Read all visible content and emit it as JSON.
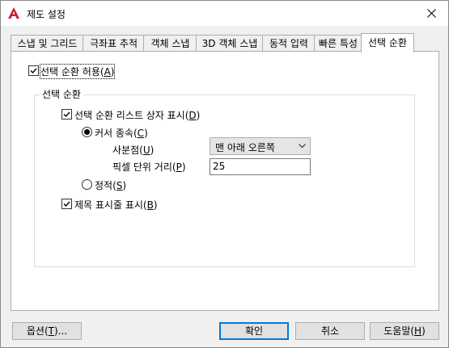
{
  "window": {
    "title": "제도 설정",
    "accent_color": "#c8232c"
  },
  "tabs": [
    {
      "label": "스냅 및 그리드"
    },
    {
      "label": "극좌표 추적"
    },
    {
      "label": "객체 스냅"
    },
    {
      "label": "3D 객체 스냅"
    },
    {
      "label": "동적 입력"
    },
    {
      "label": "빠른 특성"
    },
    {
      "label": "선택 순환"
    }
  ],
  "active_tab": "선택 순환",
  "panel": {
    "allow_cycling": {
      "label": "선택 순환 허용",
      "key": "A",
      "checked": true
    },
    "group_title": "선택 순환",
    "show_list_box": {
      "label": "선택 순환 리스트 상자 표시",
      "key": "D",
      "checked": true
    },
    "cursor_dependent": {
      "label": "커서 종속",
      "key": "C",
      "selected": true
    },
    "quadrant_label": "사분점",
    "quadrant_key": "U",
    "quadrant_value": "맨 아래 오른쪽",
    "pixel_distance_label": "픽셀 단위 거리",
    "pixel_distance_key": "P",
    "pixel_distance_value": "25",
    "static": {
      "label": "정적",
      "key": "S",
      "selected": false
    },
    "show_title_bar": {
      "label": "제목 표시줄 표시",
      "key": "B",
      "checked": true
    }
  },
  "buttons": {
    "options": {
      "label": "옵션",
      "key": "T",
      "suffix": "..."
    },
    "ok": {
      "label": "확인"
    },
    "cancel": {
      "label": "취소"
    },
    "help": {
      "label": "도움말",
      "key": "H"
    }
  }
}
